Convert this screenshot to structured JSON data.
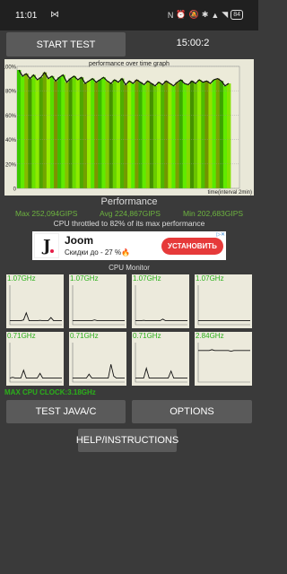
{
  "status": {
    "time": "11:01",
    "notif_icon": "mail-icon",
    "battery": "84"
  },
  "controls": {
    "start_label": "START TEST",
    "timer": "15:00:2",
    "java_label": "TEST JAVA/C",
    "options_label": "OPTIONS",
    "help_label": "HELP/INSTRUCTIONS"
  },
  "graph": {
    "title": "performance over time graph",
    "y_ticks": [
      "100%",
      "80%",
      "60%",
      "40%",
      "20%",
      "0"
    ],
    "x_label": "time(interval 2min)"
  },
  "chart_data": {
    "type": "area",
    "title": "performance over time graph",
    "xlabel": "time(interval 2min)",
    "ylabel": "",
    "ylim": [
      0,
      100
    ],
    "series": [
      {
        "values": [
          97,
          92,
          94,
          90,
          93,
          89,
          91,
          95,
          90,
          92,
          88,
          91,
          93,
          87,
          90,
          92,
          89,
          91,
          86,
          88,
          90,
          87,
          89,
          91,
          88,
          86,
          89,
          87,
          90,
          85,
          88,
          86,
          89,
          87,
          85,
          88,
          86,
          84,
          87,
          85,
          88,
          86,
          84,
          87,
          89,
          86,
          85,
          88,
          86,
          89,
          87,
          88,
          86,
          89,
          90,
          88,
          84,
          86
        ]
      }
    ]
  },
  "performance": {
    "title": "Performance",
    "max": "Max 252,094GIPS",
    "avg": "Avg 224,867GIPS",
    "min": "Min 202,683GIPS",
    "throttle": "CPU throttled to 82% of its max performance"
  },
  "ad": {
    "brand": "Joom",
    "subtitle": "Скидки до - 27 %🔥",
    "cta": "УСТАНОВИТЬ",
    "adinfo": "▷✕"
  },
  "cpu": {
    "title": "CPU Monitor",
    "max_clock": "MAX CPU CLOCK:3.18GHz",
    "cores": [
      {
        "freq": "1.07GHz",
        "levels": [
          10,
          10,
          10,
          10,
          10,
          12,
          30,
          10,
          10,
          10,
          10,
          11,
          10,
          10,
          10,
          18,
          10,
          10,
          10,
          10
        ]
      },
      {
        "freq": "1.07GHz",
        "levels": [
          10,
          10,
          10,
          10,
          10,
          10,
          10,
          10,
          12,
          10,
          10,
          10,
          10,
          10,
          10,
          10,
          10,
          10,
          10,
          10
        ]
      },
      {
        "freq": "1.07GHz",
        "levels": [
          10,
          10,
          10,
          11,
          10,
          10,
          10,
          10,
          10,
          10,
          14,
          10,
          10,
          10,
          10,
          10,
          10,
          10,
          10,
          10
        ]
      },
      {
        "freq": "1.07GHz",
        "levels": [
          10,
          10,
          10,
          10,
          10,
          10,
          10,
          10,
          10,
          10,
          10,
          10,
          10,
          10,
          10,
          10,
          10,
          10,
          10,
          10
        ]
      },
      {
        "freq": "0.71GHz",
        "levels": [
          10,
          12,
          10,
          10,
          10,
          30,
          10,
          10,
          10,
          10,
          10,
          22,
          10,
          10,
          10,
          10,
          10,
          10,
          10,
          10
        ]
      },
      {
        "freq": "0.71GHz",
        "levels": [
          10,
          10,
          10,
          10,
          10,
          10,
          20,
          10,
          10,
          10,
          10,
          10,
          10,
          10,
          45,
          15,
          10,
          10,
          10,
          10
        ]
      },
      {
        "freq": "0.71GHz",
        "levels": [
          10,
          10,
          10,
          10,
          35,
          10,
          10,
          10,
          10,
          10,
          10,
          10,
          10,
          28,
          10,
          10,
          10,
          10,
          10,
          10
        ]
      },
      {
        "freq": "2.84GHz",
        "levels": [
          80,
          80,
          80,
          80,
          80,
          82,
          80,
          80,
          80,
          80,
          80,
          80,
          78,
          80,
          80,
          80,
          80,
          80,
          80,
          80
        ]
      }
    ]
  }
}
